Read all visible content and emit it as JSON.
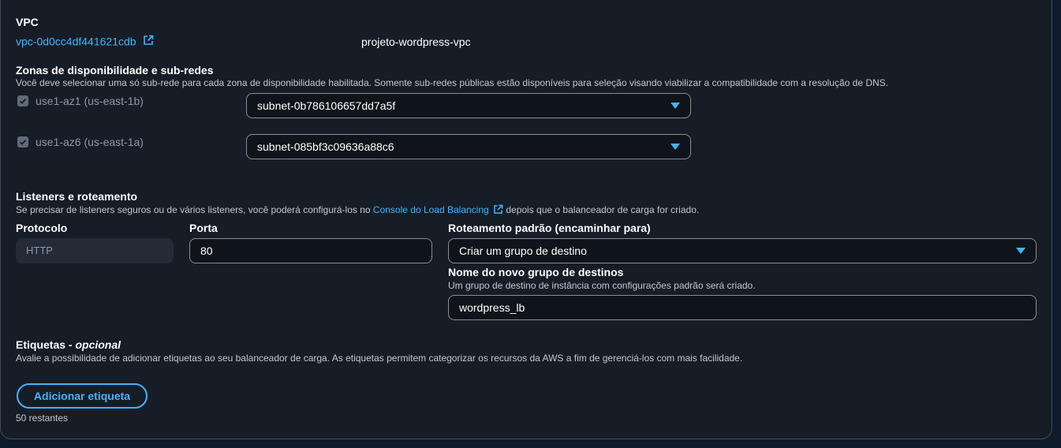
{
  "vpc": {
    "heading": "VPC",
    "id_link": "vpc-0d0cc4df441621cdb",
    "name": "projeto-wordpress-vpc"
  },
  "zones": {
    "heading": "Zonas de disponibilidade e sub-redes",
    "description": "Você deve selecionar uma só sub-rede para cada zona de disponibilidade habilitada. Somente sub-redes públicas estão disponíveis para seleção visando viabilizar a compatibilidade com a resolução de DNS.",
    "items": [
      {
        "az_label": "use1-az1 (us-east-1b)",
        "checked": true,
        "subnet": "subnet-0b786106657dd7a5f"
      },
      {
        "az_label": "use1-az6 (us-east-1a)",
        "checked": true,
        "subnet": "subnet-085bf3c09636a88c6"
      }
    ]
  },
  "listeners": {
    "heading": "Listeners e roteamento",
    "description_before": "Se precisar de listeners seguros ou de vários listeners, você poderá configurá-los no ",
    "description_link": "Console do Load Balancing",
    "description_after": " depois que o balanceador de carga for criado.",
    "protocol_label": "Protocolo",
    "protocol_value": "HTTP",
    "port_label": "Porta",
    "port_value": "80",
    "routing_label": "Roteamento padrão (encaminhar para)",
    "routing_value": "Criar um grupo de destino",
    "target_group_label": "Nome do novo grupo de destinos",
    "target_group_desc": "Um grupo de destino de instância com configurações padrão será criado.",
    "target_group_value": "wordpress_lb"
  },
  "tags": {
    "heading": "Etiquetas - ",
    "heading_optional": "opcional",
    "description": "Avalie a possibilidade de adicionar etiquetas ao seu balanceador de carga. As etiquetas permitem categorizar os recursos da AWS a fim de gerenciá-los com mais facilidade.",
    "add_button": "Adicionar etiqueta",
    "remaining": "50 restantes"
  },
  "colors": {
    "accent": "#42b4ff",
    "panel_bg": "#161d26",
    "page_bg": "#0f1b2a"
  }
}
